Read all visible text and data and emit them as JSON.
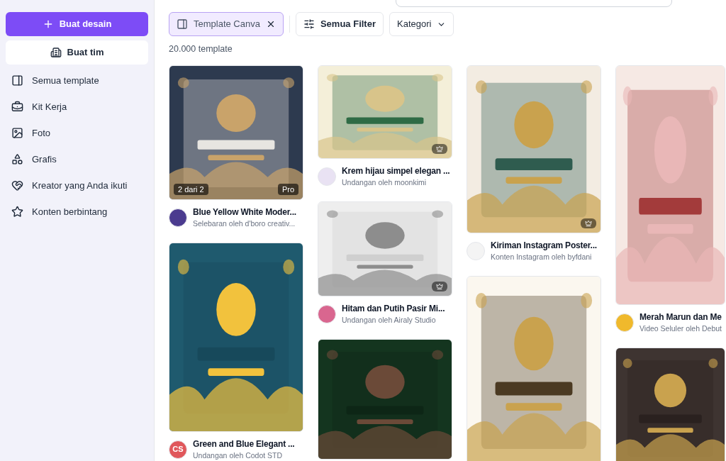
{
  "sidebar": {
    "create_button": "Buat desain",
    "team_button": "Buat tim",
    "items": [
      {
        "label": "Semua template",
        "selected": false
      },
      {
        "label": "Kit Kerja",
        "selected": false
      },
      {
        "label": "Foto",
        "selected": false
      },
      {
        "label": "Grafis",
        "selected": false
      },
      {
        "label": "Kreator yang Anda ikuti",
        "selected": false
      },
      {
        "label": "Konten berbintang",
        "selected": false
      }
    ]
  },
  "filters": [
    {
      "kind": "chip",
      "label": "Template Canva",
      "selected": true
    },
    {
      "kind": "filter",
      "label": "Semua Filter",
      "selected": false
    },
    {
      "kind": "dropdown",
      "label": "Kategori",
      "selected": false
    }
  ],
  "result_count": "20.000 template",
  "columns": [
    [
      {
        "title": "Blue Yellow White Moder...",
        "subtitle": "Selebaran oleh d'boro creativ...",
        "page_count": "2 dari 2",
        "pro_label": "Pro",
        "premium": false
      },
      {
        "title": "Green and Blue Elegant ...",
        "subtitle": "Undangan oleh Codot STD",
        "avatar_initials": "CS",
        "premium": false
      }
    ],
    [
      {
        "title": "Krem hijau simpel elegan ...",
        "subtitle": "Undangan oleh moonkimi",
        "premium": true
      },
      {
        "title": "Hitam dan Putih Pasir Mi...",
        "subtitle": "Undangan oleh Airaly Studio",
        "premium": true
      },
      {
        "premium": false
      }
    ],
    [
      {
        "title": "Kiriman Instagram Poster...",
        "subtitle": "Konten Instagram oleh byfdani",
        "premium": true
      },
      {
        "premium": false
      }
    ],
    [
      {
        "title": "Merah Marun dan Me",
        "subtitle": "Video Seluler oleh Debut",
        "premium": false
      },
      {
        "premium": false
      }
    ]
  ]
}
